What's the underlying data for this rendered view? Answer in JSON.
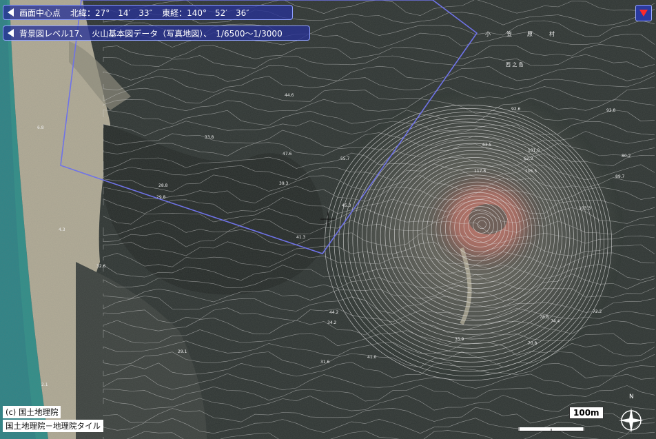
{
  "header": {
    "center_label": "画面中心点",
    "lat_label": "北緯：",
    "lat_value": "27°　14′　33″",
    "lon_label": "東経：",
    "lon_value": "140°　52′　36″"
  },
  "layer": {
    "text": "背景図レベル17、　火山基本図データ（写真地図）、　1/6500～1/3000"
  },
  "credits": {
    "line1": "(c) 国土地理院",
    "line2": "国土地理院－地理院タイル"
  },
  "scale": {
    "label": "100m"
  },
  "compass": {
    "north": "N"
  },
  "map_labels": {
    "village_chars": [
      "小",
      "笠",
      "原",
      "村"
    ],
    "district": "西 之 島"
  },
  "elevations": [
    "44.6",
    "39.3",
    "47.6",
    "55.7",
    "33.8",
    "45.3",
    "41.3",
    "29.8",
    "32.6",
    "28.8",
    "62.3",
    "63.5",
    "101.0",
    "117.8",
    "103.3",
    "92.6",
    "92.8",
    "80.2",
    "89.7",
    "105.5",
    "78.8",
    "70.8",
    "72.2",
    "74.4",
    "44.2",
    "34.2",
    "31.6",
    "41.0",
    "35.9",
    "6.8",
    "4.3",
    "2.1",
    "29.1"
  ],
  "colors": {
    "panel": "#2838a0",
    "frame": "#6f73e8",
    "sea": "#2f8f8a",
    "sand": "#b9b19a"
  }
}
